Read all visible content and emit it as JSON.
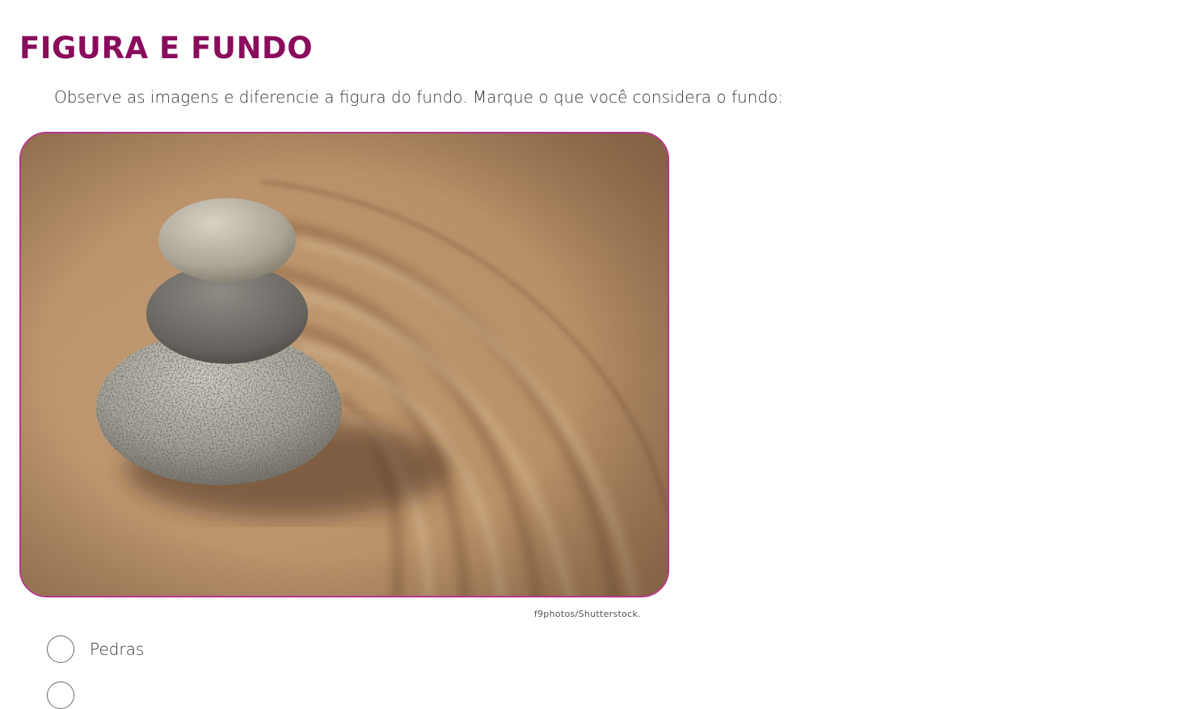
{
  "title": "FIGURA E FUNDO",
  "instruction": "Observe as imagens e diferencie a figura do fundo. Marque o que você considera o fundo:",
  "image_credit": "f9photos/Shutterstock.",
  "options": [
    {
      "label": "Pedras"
    },
    {
      "label": ""
    }
  ],
  "colors": {
    "title": "#8a0c5c",
    "frame_border": "#b5368a"
  }
}
